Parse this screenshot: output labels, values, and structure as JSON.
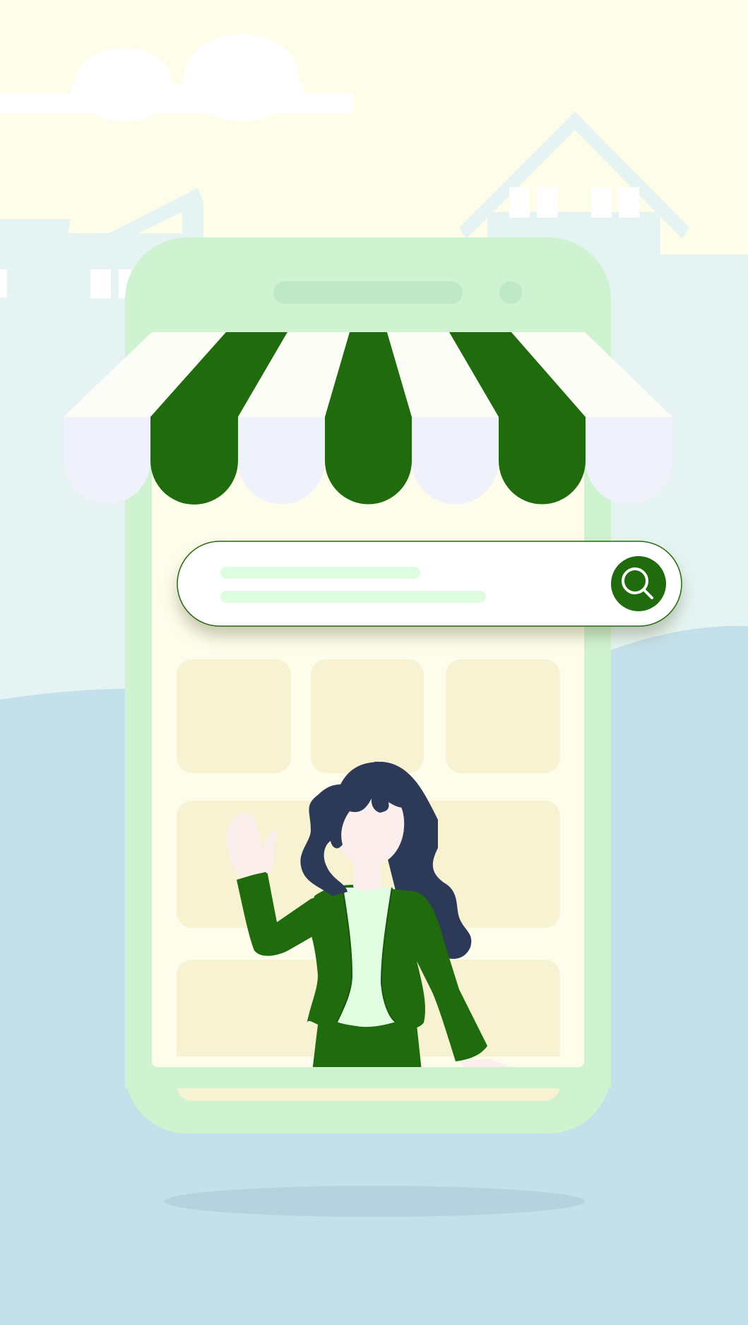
{
  "illustration": {
    "theme": "online-shop-splash",
    "colors": {
      "sky": "#fefdea",
      "ground_far": "#e5f4f2",
      "ground_near": "#c4e0ea",
      "phone_frame": "#cff2d0",
      "screen": "#fefdec",
      "tile": "#f6f2d2",
      "brand_green": "#206b0e",
      "awning_white": "#fdfdf7",
      "awning_lavender": "#eff2fb",
      "search_field": "#ffffff",
      "search_placeholder_lines": "#defde0",
      "hair": "#2c3a58",
      "skin": "#fbeeed",
      "shirt": "#e1fee2"
    },
    "icons": [
      "cloud-icon",
      "house-icon",
      "magnifier-icon",
      "storefront-awning",
      "woman-waving-figure"
    ],
    "search_bar": {
      "placeholder_text": "",
      "button_icon": "magnifier-icon"
    },
    "product_tiles": {
      "row_1_count": 3,
      "rows_total": 3
    }
  }
}
